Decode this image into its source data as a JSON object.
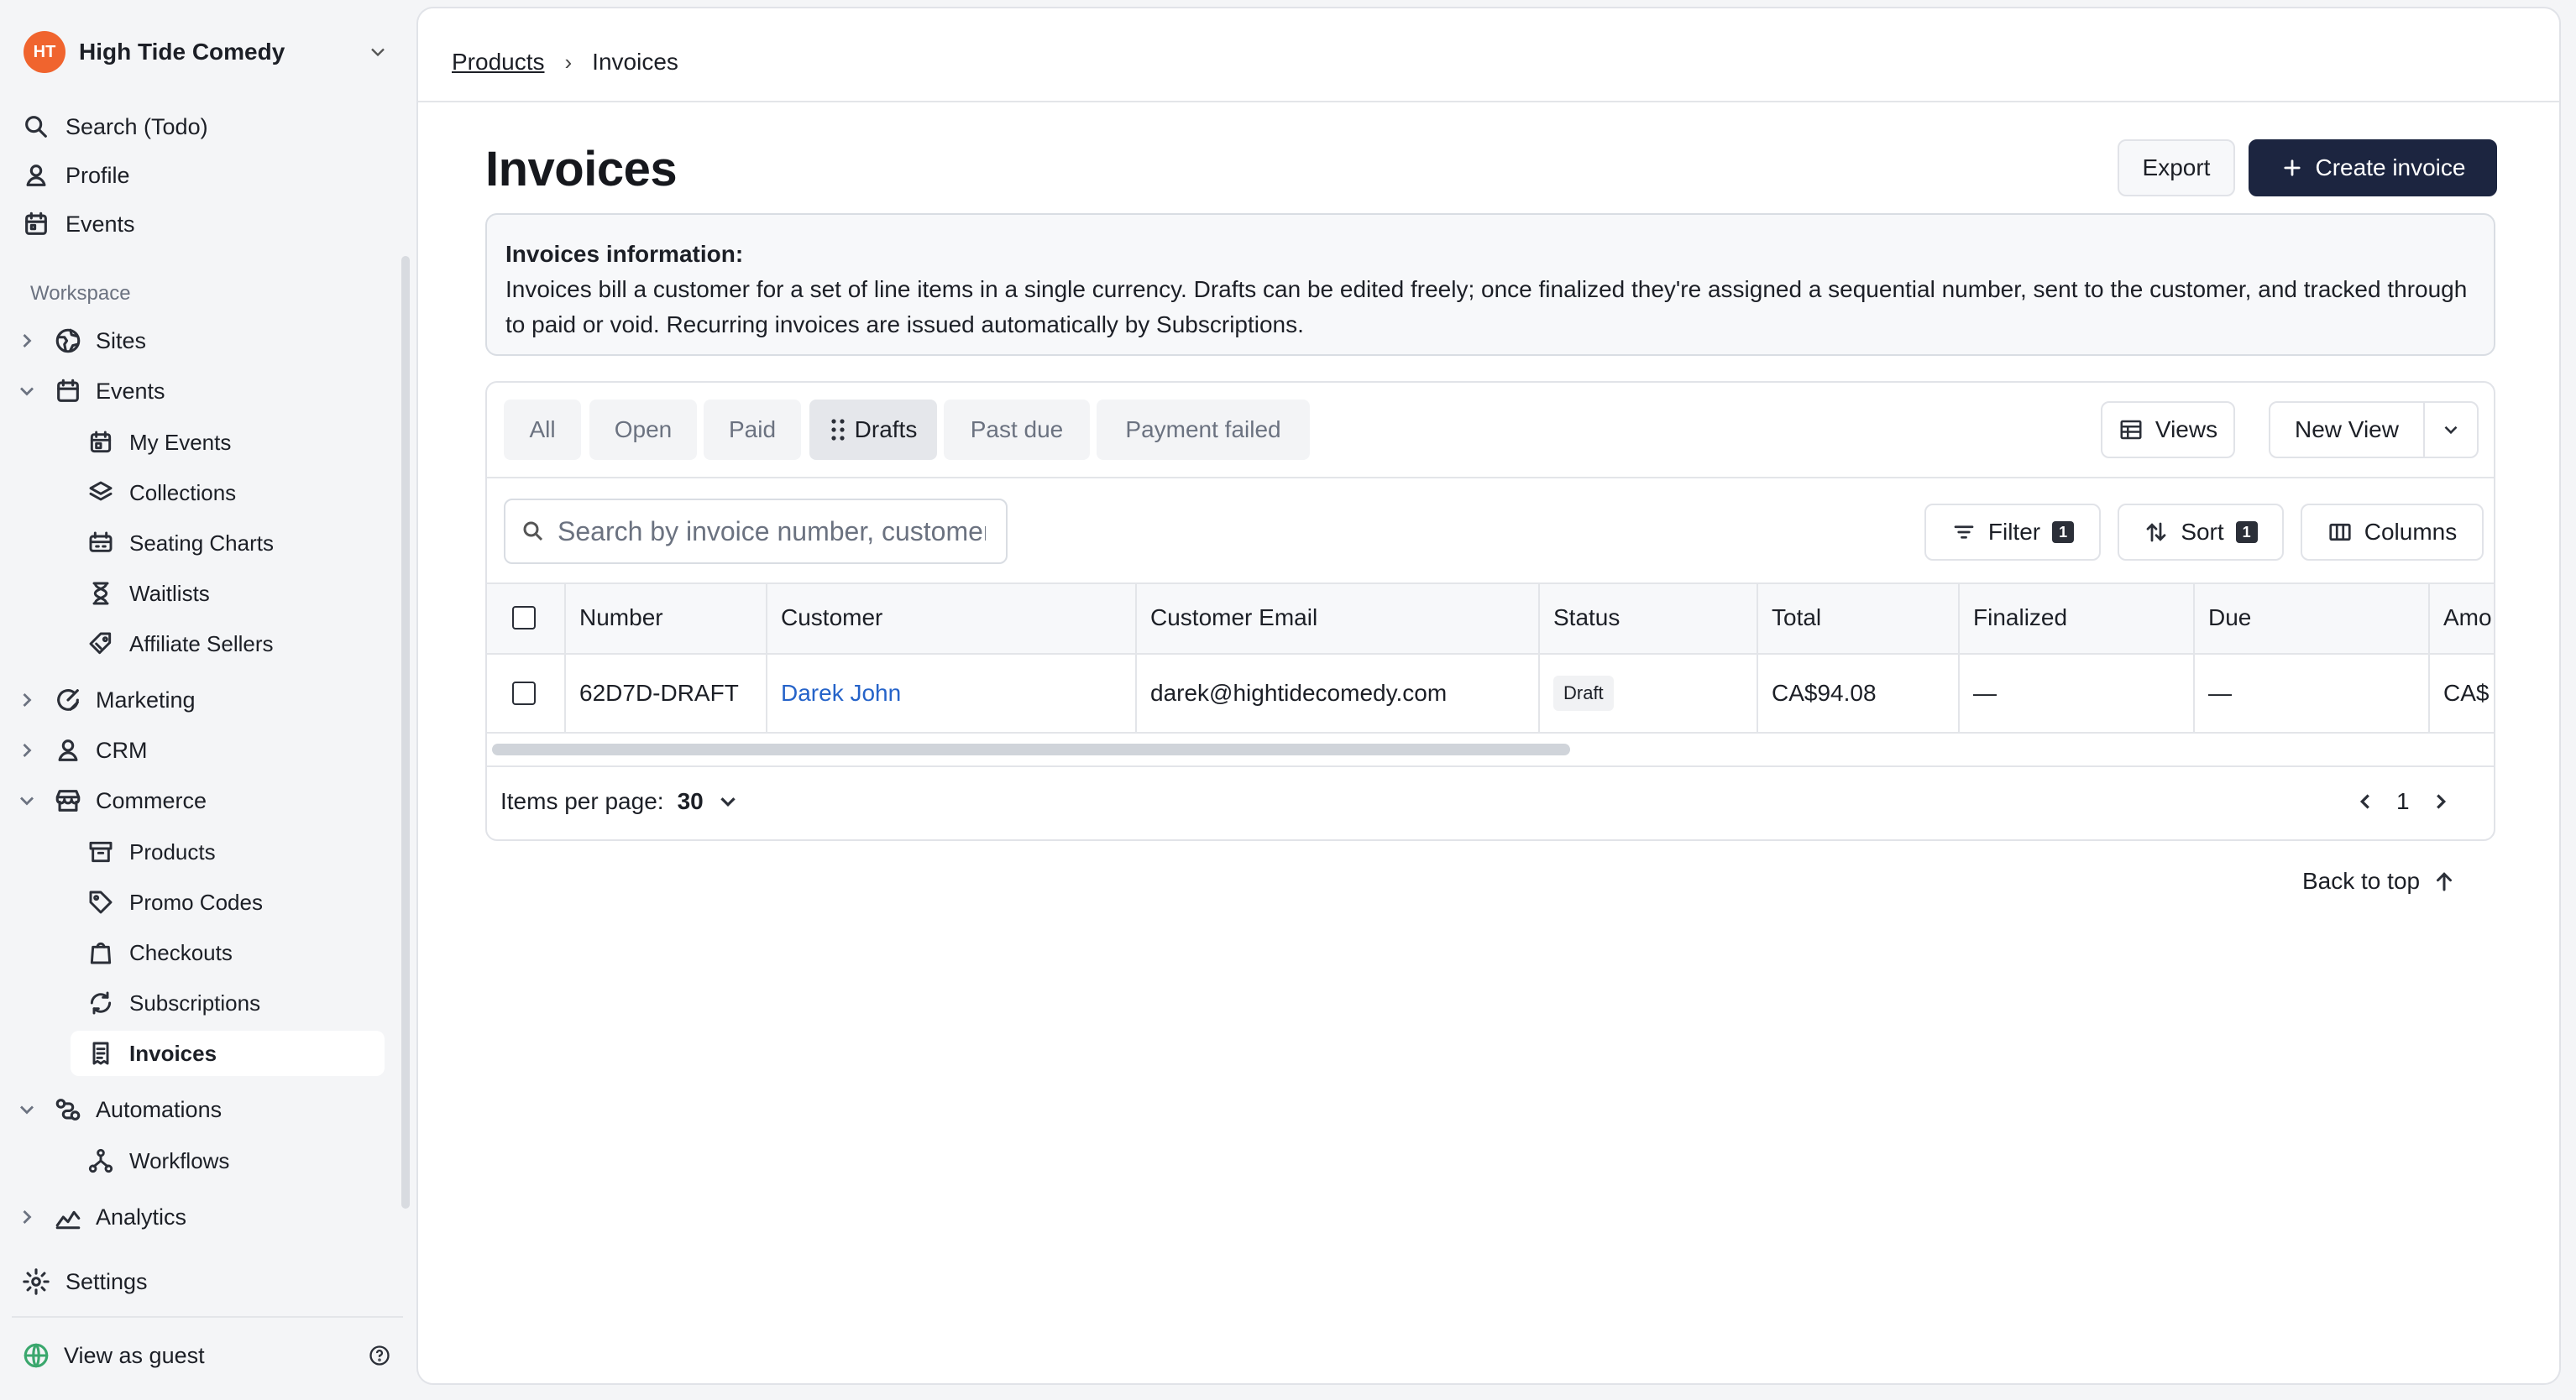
{
  "org": {
    "logo_text": "HT",
    "name": "High Tide Comedy"
  },
  "nav_top": [
    {
      "label": "Search (Todo)",
      "icon": "search-icon"
    },
    {
      "label": "Profile",
      "icon": "user-icon"
    },
    {
      "label": "Events",
      "icon": "calendar-icon"
    }
  ],
  "workspace_label": "Workspace",
  "sidebar": {
    "sites": "Sites",
    "events": "Events",
    "my_events": "My Events",
    "collections": "Collections",
    "seating_charts": "Seating Charts",
    "waitlists": "Waitlists",
    "affiliate_sellers": "Affiliate Sellers",
    "marketing": "Marketing",
    "crm": "CRM",
    "commerce": "Commerce",
    "products": "Products",
    "promo_codes": "Promo Codes",
    "checkouts": "Checkouts",
    "subscriptions": "Subscriptions",
    "invoices": "Invoices",
    "automations": "Automations",
    "workflows": "Workflows",
    "analytics": "Analytics",
    "settings": "Settings",
    "view_as_guest": "View as guest"
  },
  "breadcrumb": {
    "parent": "Products",
    "separator": "›",
    "current": "Invoices"
  },
  "page": {
    "title": "Invoices",
    "export_label": "Export",
    "create_label": "Create invoice",
    "info_title": "Invoices information:",
    "info_body": "Invoices bill a customer for a set of line items in a single currency. Drafts can be edited freely; once finalized they're assigned a sequential number, sent to the customer, and tracked through to paid or void. Recurring invoices are issued automatically by Subscriptions."
  },
  "tabs": [
    "All",
    "Open",
    "Paid",
    "Drafts",
    "Past due",
    "Payment failed"
  ],
  "active_tab": "Drafts",
  "views": {
    "views_label": "Views",
    "new_view_label": "New View"
  },
  "search": {
    "placeholder": "Search by invoice number, customer"
  },
  "toolbar": {
    "filter_label": "Filter",
    "filter_count": "1",
    "sort_label": "Sort",
    "sort_count": "1",
    "columns_label": "Columns"
  },
  "table": {
    "columns": [
      "Number",
      "Customer",
      "Customer Email",
      "Status",
      "Total",
      "Finalized",
      "Due",
      "Amo"
    ],
    "rows": [
      {
        "number": "62D7D-DRAFT",
        "customer": "Darek John",
        "email": "darek@hightidecomedy.com",
        "status": "Draft",
        "total": "CA$94.08",
        "finalized": "—",
        "due": "—",
        "amount": "CA$"
      }
    ]
  },
  "pagination": {
    "items_per_page_label": "Items per page:",
    "items_per_page": "30",
    "page": "1"
  },
  "back_to_top": "Back to top",
  "colors": {
    "accent": "#1c2540",
    "link": "#2563c9",
    "logo": "#f0642e"
  }
}
